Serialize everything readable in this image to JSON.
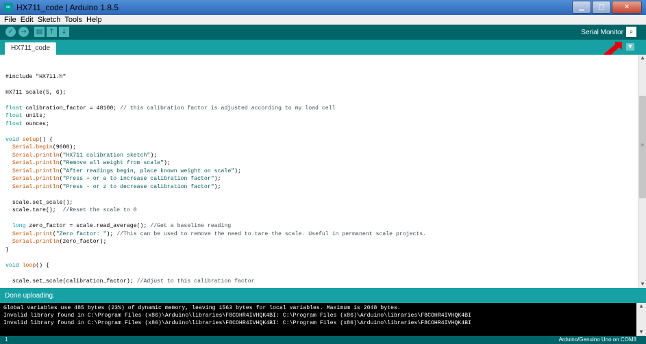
{
  "window": {
    "title": "HX711_code | Arduino 1.8.5",
    "icon": "arduino-logo-icon",
    "controls": {
      "minimize": "minimize-icon",
      "maximize": "maximize-icon",
      "close": "close-icon"
    }
  },
  "menu": {
    "items": [
      "File",
      "Edit",
      "Sketch",
      "Tools",
      "Help"
    ]
  },
  "toolbar": {
    "buttons": [
      {
        "name": "verify-button",
        "icon": "checkmark-icon",
        "glyph": "✓"
      },
      {
        "name": "upload-button",
        "icon": "arrow-right-icon",
        "glyph": "→"
      },
      {
        "name": "new-button",
        "icon": "new-file-icon",
        "glyph": "▤"
      },
      {
        "name": "open-button",
        "icon": "arrow-up-icon",
        "glyph": "↑"
      },
      {
        "name": "save-button",
        "icon": "arrow-down-icon",
        "glyph": "↓"
      }
    ],
    "serial_monitor_label": "Serial Monitor",
    "serial_monitor_icon": "magnifier-icon"
  },
  "tabs": {
    "active": "HX711_code",
    "menu_icon": "chevron-down-icon"
  },
  "editor": {
    "lines": [
      [],
      [
        [
          "",
          "#include \"HX711.h\""
        ]
      ],
      [],
      [
        [
          "",
          "HX711 scale(5, 6);"
        ]
      ],
      [],
      [
        [
          "kw",
          "float"
        ],
        [
          "",
          " calibration_factor = 48100; "
        ],
        [
          "cm",
          "// this calibration factor is adjusted according to my load cell"
        ]
      ],
      [
        [
          "kw",
          "float"
        ],
        [
          "",
          " units;"
        ]
      ],
      [
        [
          "kw",
          "float"
        ],
        [
          "",
          " ounces;"
        ]
      ],
      [],
      [
        [
          "kw",
          "void"
        ],
        [
          "",
          " "
        ],
        [
          "fn",
          "setup"
        ],
        [
          "",
          "() {"
        ]
      ],
      [
        [
          "",
          "  "
        ],
        [
          "fn",
          "Serial"
        ],
        [
          "",
          "."
        ],
        [
          "fn",
          "begin"
        ],
        [
          "",
          "(9600);"
        ]
      ],
      [
        [
          "",
          "  "
        ],
        [
          "fn",
          "Serial"
        ],
        [
          "",
          "."
        ],
        [
          "fn",
          "println"
        ],
        [
          "",
          "("
        ],
        [
          "st",
          "\"HX711 calibration sketch\""
        ],
        [
          "",
          ");"
        ]
      ],
      [
        [
          "",
          "  "
        ],
        [
          "fn",
          "Serial"
        ],
        [
          "",
          "."
        ],
        [
          "fn",
          "println"
        ],
        [
          "",
          "("
        ],
        [
          "st",
          "\"Remove all weight from scale\""
        ],
        [
          "",
          ");"
        ]
      ],
      [
        [
          "",
          "  "
        ],
        [
          "fn",
          "Serial"
        ],
        [
          "",
          "."
        ],
        [
          "fn",
          "println"
        ],
        [
          "",
          "("
        ],
        [
          "st",
          "\"After readings begin, place known weight on scale\""
        ],
        [
          "",
          ");"
        ]
      ],
      [
        [
          "",
          "  "
        ],
        [
          "fn",
          "Serial"
        ],
        [
          "",
          "."
        ],
        [
          "fn",
          "println"
        ],
        [
          "",
          "("
        ],
        [
          "st",
          "\"Press + or a to increase calibration factor\""
        ],
        [
          "",
          ");"
        ]
      ],
      [
        [
          "",
          "  "
        ],
        [
          "fn",
          "Serial"
        ],
        [
          "",
          "."
        ],
        [
          "fn",
          "println"
        ],
        [
          "",
          "("
        ],
        [
          "st",
          "\"Press - or z to decrease calibration factor\""
        ],
        [
          "",
          ");"
        ]
      ],
      [],
      [
        [
          "",
          "  scale.set_scale();"
        ]
      ],
      [
        [
          "",
          "  scale.tare();  "
        ],
        [
          "cm",
          "//Reset the scale to 0"
        ]
      ],
      [],
      [
        [
          "",
          "  "
        ],
        [
          "kw",
          "long"
        ],
        [
          "",
          " zero_factor = scale.read_average(); "
        ],
        [
          "cm",
          "//Get a baseline reading"
        ]
      ],
      [
        [
          "",
          "  "
        ],
        [
          "fn",
          "Serial"
        ],
        [
          "",
          "."
        ],
        [
          "fn",
          "print"
        ],
        [
          "",
          "("
        ],
        [
          "st",
          "\"Zero factor: \""
        ],
        [
          "",
          "); "
        ],
        [
          "cm",
          "//This can be used to remove the need to tare the scale. Useful in permanent scale projects."
        ]
      ],
      [
        [
          "",
          "  "
        ],
        [
          "fn",
          "Serial"
        ],
        [
          "",
          "."
        ],
        [
          "fn",
          "println"
        ],
        [
          "",
          "(zero_factor);"
        ]
      ],
      [
        [
          "",
          "}"
        ]
      ],
      [],
      [
        [
          "kw",
          "void"
        ],
        [
          "",
          " "
        ],
        [
          "fn",
          "loop"
        ],
        [
          "",
          "() {"
        ]
      ],
      [],
      [
        [
          "",
          "  scale.set_scale(calibration_factor); "
        ],
        [
          "cm",
          "//Adjust to this calibration factor"
        ]
      ]
    ]
  },
  "status": {
    "message": "Done uploading."
  },
  "console": {
    "lines": [
      "Global variables use 485 bytes (23%) of dynamic memory, leaving 1563 bytes for local variables. Maximum is 2048 bytes.",
      "Invalid library found in C:\\Program Files (x86)\\Arduino\\libraries\\F8COHR4IVHQK4BI: C:\\Program Files (x86)\\Arduino\\libraries\\F8COHR4IVHQK4BI",
      "Invalid library found in C:\\Program Files (x86)\\Arduino\\libraries\\F8COHR4IVHQK4BI: C:\\Program Files (x86)\\Arduino\\libraries\\F8COHR4IVHQK4BI"
    ]
  },
  "footer": {
    "line_number": "1",
    "board": "Arduino/Genuino Uno on COM8"
  },
  "colors": {
    "teal_dark": "#006468",
    "teal": "#17a1a5",
    "arrow": "#e8000b"
  }
}
